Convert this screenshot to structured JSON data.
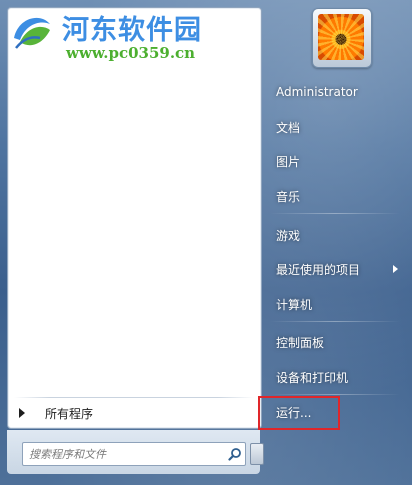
{
  "watermark": {
    "title": "河东软件园",
    "url": "www.pc0359.cn"
  },
  "start_menu": {
    "all_programs_label": "所有程序",
    "search": {
      "placeholder": "搜索程序和文件"
    },
    "right_items": [
      {
        "label": "Administrator"
      },
      {
        "label": "文档"
      },
      {
        "label": "图片"
      },
      {
        "label": "音乐"
      },
      {
        "label": "游戏"
      },
      {
        "label": "最近使用的项目"
      },
      {
        "label": "计算机"
      },
      {
        "label": "控制面板"
      },
      {
        "label": "设备和打印机"
      },
      {
        "label": "运行..."
      }
    ]
  },
  "colors": {
    "highlight_box": "#e0262a",
    "watermark_title": "#3d8ee3",
    "watermark_url": "#4caf2f"
  }
}
